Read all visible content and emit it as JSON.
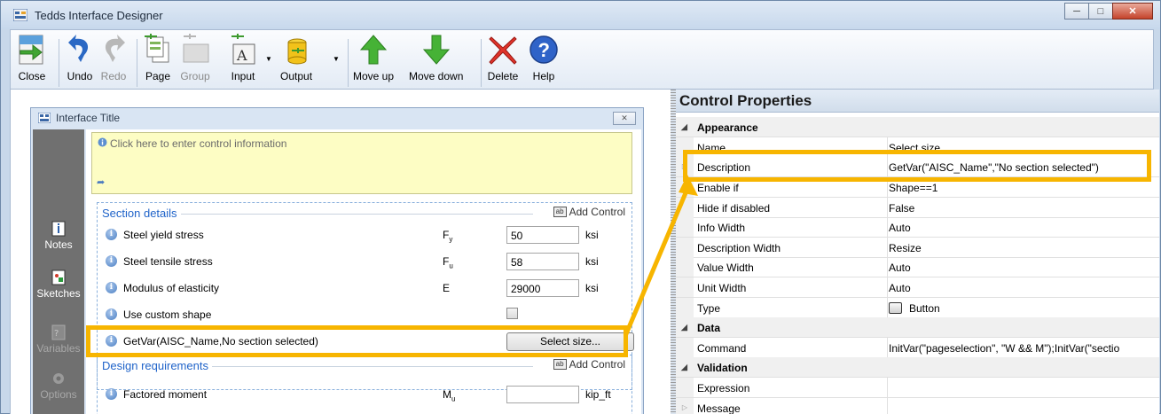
{
  "window": {
    "title": "Tedds Interface Designer"
  },
  "toolbar": {
    "close": "Close",
    "undo": "Undo",
    "redo": "Redo",
    "page": "Page",
    "group": "Group",
    "input": "Input",
    "output": "Output",
    "move_up": "Move up",
    "move_down": "Move down",
    "delete": "Delete",
    "help": "Help"
  },
  "designer": {
    "title": "Interface Title",
    "sidebar": [
      {
        "label": "Notes",
        "icon": "notes-icon"
      },
      {
        "label": "Sketches",
        "icon": "sketches-icon"
      },
      {
        "label": "Variables",
        "icon": "variables-icon"
      },
      {
        "label": "Options",
        "icon": "options-icon"
      }
    ],
    "info_placeholder": "Click here to enter control information",
    "add_control": "Add Control",
    "sections": [
      {
        "name": "Section details",
        "rows": [
          {
            "label": "Steel yield stress",
            "sym": "F",
            "sub": "y",
            "value": "50",
            "unit": "ksi"
          },
          {
            "label": "Steel tensile stress",
            "sym": "F",
            "sub": "u",
            "value": "58",
            "unit": "ksi"
          },
          {
            "label": "Modulus of elasticity",
            "sym": "E",
            "sub": "",
            "value": "29000",
            "unit": "ksi"
          },
          {
            "label": "Use custom shape"
          },
          {
            "label": "GetVar(AISC_Name,No section selected)",
            "button": "Select size..."
          }
        ]
      },
      {
        "name": "Design requirements",
        "rows": [
          {
            "label": "Factored moment",
            "sym": "M",
            "sub": "u",
            "value": "",
            "unit": "kip_ft"
          }
        ]
      }
    ]
  },
  "properties": {
    "title": "Control Properties",
    "categories": {
      "appearance": "Appearance",
      "data": "Data",
      "validation": "Validation"
    },
    "rows": {
      "name": {
        "name": "Name",
        "value": "Select size..."
      },
      "description": {
        "name": "Description",
        "value": "GetVar(\"AISC_Name\",\"No section selected\")"
      },
      "enable_if": {
        "name": "Enable if",
        "value": "Shape==1"
      },
      "hide_if_disabled": {
        "name": "Hide if disabled",
        "value": "False"
      },
      "info_width": {
        "name": "Info Width",
        "value": "Auto"
      },
      "description_width": {
        "name": "Description Width",
        "value": "Resize"
      },
      "value_width": {
        "name": "Value Width",
        "value": "Auto"
      },
      "unit_width": {
        "name": "Unit Width",
        "value": "Auto"
      },
      "type": {
        "name": "Type",
        "value": "Button"
      },
      "command": {
        "name": "Command",
        "value": "InitVar(\"pageselection\", \"W && M\");InitVar(\"sectio"
      },
      "expression": {
        "name": "Expression",
        "value": ""
      },
      "message": {
        "name": "Message",
        "value": ""
      }
    }
  },
  "colors": {
    "highlight": "#f7b500",
    "section_title": "#1f63c9",
    "info_bg": "#fdfdc4"
  }
}
